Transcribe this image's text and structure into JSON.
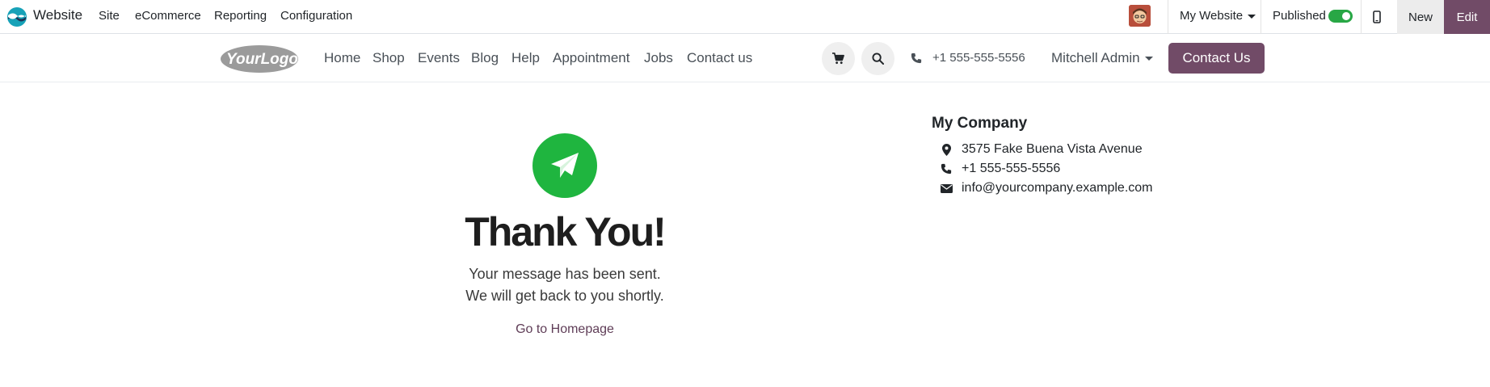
{
  "admin_bar": {
    "app_name": "Website",
    "menus": [
      "Site",
      "eCommerce",
      "Reporting",
      "Configuration"
    ],
    "website_selector": "My Website",
    "published_label": "Published",
    "published": true,
    "new_label": "New",
    "edit_label": "Edit",
    "accent_color": "#714b67",
    "toggle_color": "#28a745"
  },
  "site_header": {
    "logo_text": "YourLogo",
    "nav_items": [
      "Home",
      "Shop",
      "Events",
      "Blog",
      "Help",
      "Appointment",
      "Jobs",
      "Contact us"
    ],
    "phone": "+1 555-555-5556",
    "user": "Mitchell Admin",
    "cta_label": "Contact Us",
    "icons": [
      "cart-icon",
      "search-icon",
      "phone-icon"
    ]
  },
  "thank_you": {
    "icon": "paper-plane-icon",
    "icon_color": "#1fb53f",
    "title": "Thank You!",
    "line1": "Your message has been sent.",
    "line2": "We will get back to you shortly.",
    "link_label": "Go to Homepage"
  },
  "company": {
    "name": "My Company",
    "address": "3575 Fake Buena Vista Avenue",
    "phone": "+1 555-555-5556",
    "email": "info@yourcompany.example.com"
  }
}
